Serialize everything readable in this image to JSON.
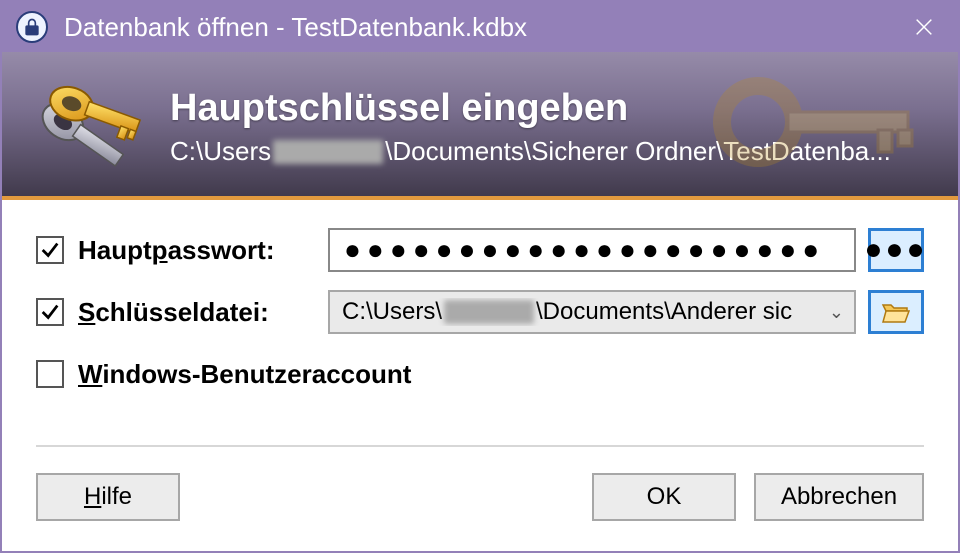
{
  "window": {
    "title": "Datenbank öffnen - TestDatenbank.kdbx"
  },
  "banner": {
    "title": "Hauptschlüssel eingeben",
    "path_prefix": "C:\\Users",
    "path_suffix": "\\Documents\\Sicherer Ordner\\TestDatenba..."
  },
  "form": {
    "master_password": {
      "checked": true,
      "label_pre": "Haupt",
      "label_ul": "p",
      "label_post": "asswort:",
      "value": "●●●●●●●●●●●●●●●●●●●●●"
    },
    "key_file": {
      "checked": true,
      "label_ul": "S",
      "label_post": "chlüsseldatei:",
      "value_prefix": "C:\\Users\\",
      "value_suffix": "\\Documents\\Anderer sic"
    },
    "windows_account": {
      "checked": false,
      "label_ul": "W",
      "label_post": "indows-Benutzeraccount"
    }
  },
  "footer": {
    "help_ul": "H",
    "help_post": "ilfe",
    "ok": "OK",
    "cancel": "Abbrechen"
  },
  "icons": {
    "dots": "●●●"
  }
}
